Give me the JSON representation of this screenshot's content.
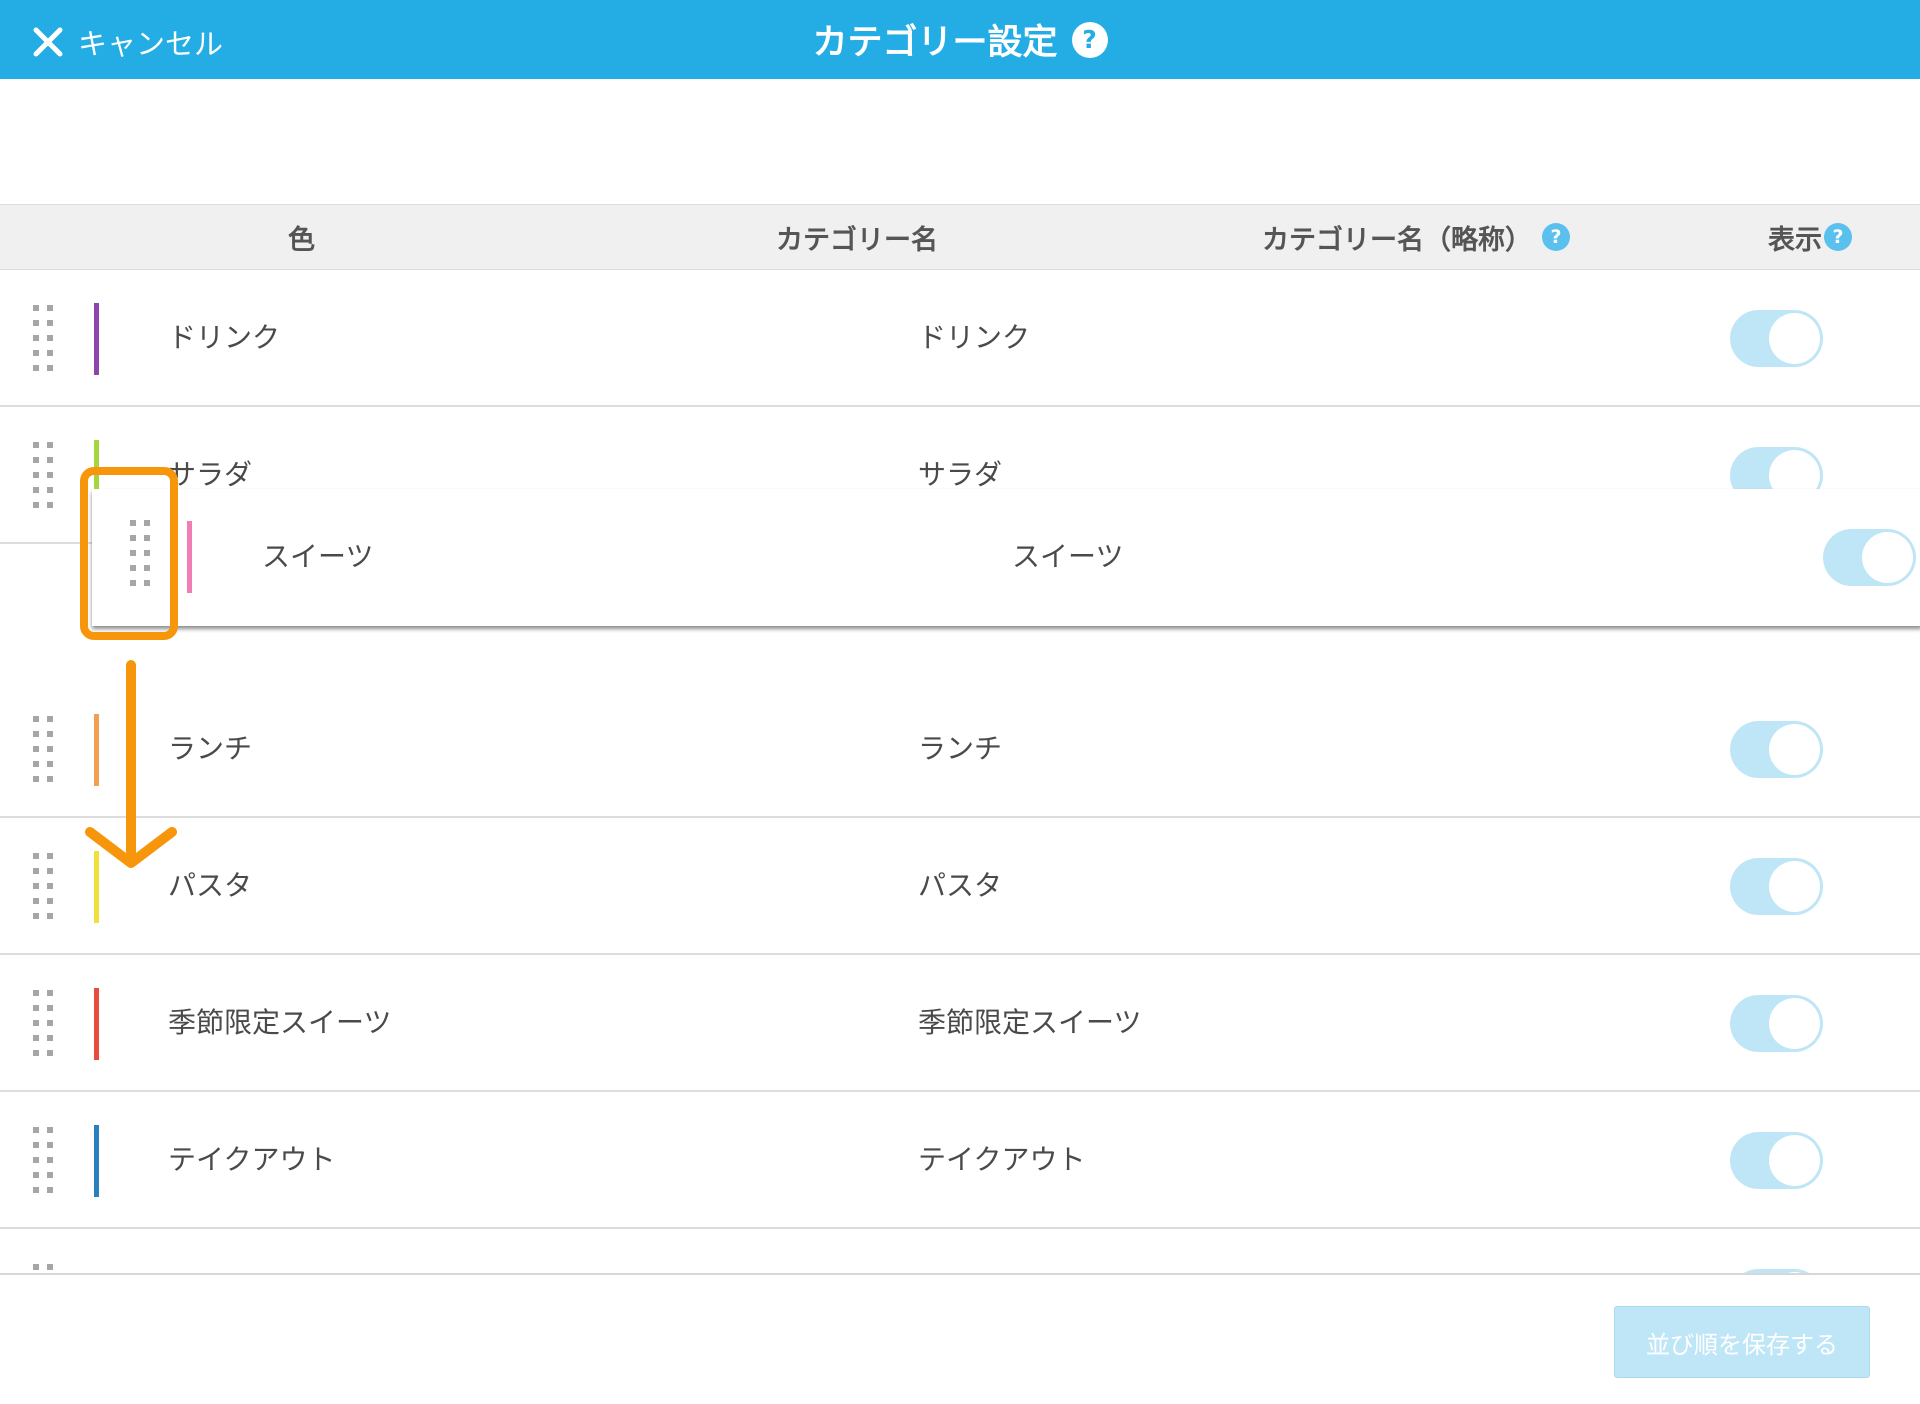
{
  "header": {
    "cancel_label": "キャンセル",
    "title": "カテゴリー設定",
    "help_icon": "?"
  },
  "columns": {
    "color": "色",
    "name": "カテゴリー名",
    "short_name": "カテゴリー名（略称）",
    "visible": "表示",
    "help_icon": "?"
  },
  "rows": [
    {
      "name": "ドリンク",
      "short": "ドリンク",
      "color": "#8e44ad",
      "visible": true
    },
    {
      "name": "サラダ",
      "short": "サラダ",
      "color": "#a5d63f",
      "visible": true
    },
    {
      "name": "ランチ",
      "short": "ランチ",
      "color": "#f0a050",
      "visible": true
    },
    {
      "name": "パスタ",
      "short": "パスタ",
      "color": "#f2e03a",
      "visible": true
    },
    {
      "name": "季節限定スイーツ",
      "short": "季節限定スイーツ",
      "color": "#e74c3c",
      "visible": true
    },
    {
      "name": "テイクアウト",
      "short": "テイクアウト",
      "color": "#2a7fbf",
      "visible": true
    }
  ],
  "dragging_row": {
    "name": "スイーツ",
    "short": "スイーツ",
    "color": "#f27db4",
    "visible": true
  },
  "footer": {
    "save_label": "並び順を保存する"
  },
  "annotation": {
    "color": "#f7960b"
  }
}
